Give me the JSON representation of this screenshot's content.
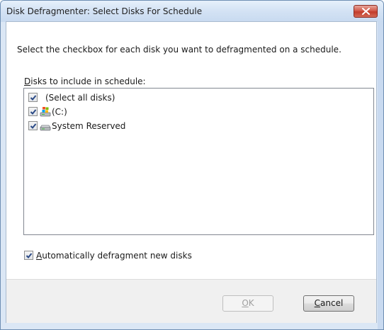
{
  "window": {
    "title": "Disk Defragmenter: Select Disks For Schedule"
  },
  "instruction": "Select the checkbox for each disk you want to defragmented on a schedule.",
  "disks_label": {
    "mnemonic": "D",
    "rest": "isks to include in schedule:"
  },
  "disks": [
    {
      "label": "(Select all disks)",
      "checked": true,
      "icon": "none"
    },
    {
      "label": "(C:)",
      "checked": true,
      "icon": "windows-drive-icon"
    },
    {
      "label": "System Reserved",
      "checked": true,
      "icon": "hard-drive-icon"
    }
  ],
  "auto_defrag": {
    "mnemonic": "A",
    "rest": "utomatically defragment new disks",
    "checked": true
  },
  "buttons": {
    "ok_mnemonic": "O",
    "ok_rest": "K",
    "ok_enabled": false,
    "cancel_mnemonic": "C",
    "cancel_rest": "ancel"
  },
  "colors": {
    "title_bar": "#d3e2f4",
    "close_button": "#c23c2b",
    "footer": "#f0f0f0"
  }
}
